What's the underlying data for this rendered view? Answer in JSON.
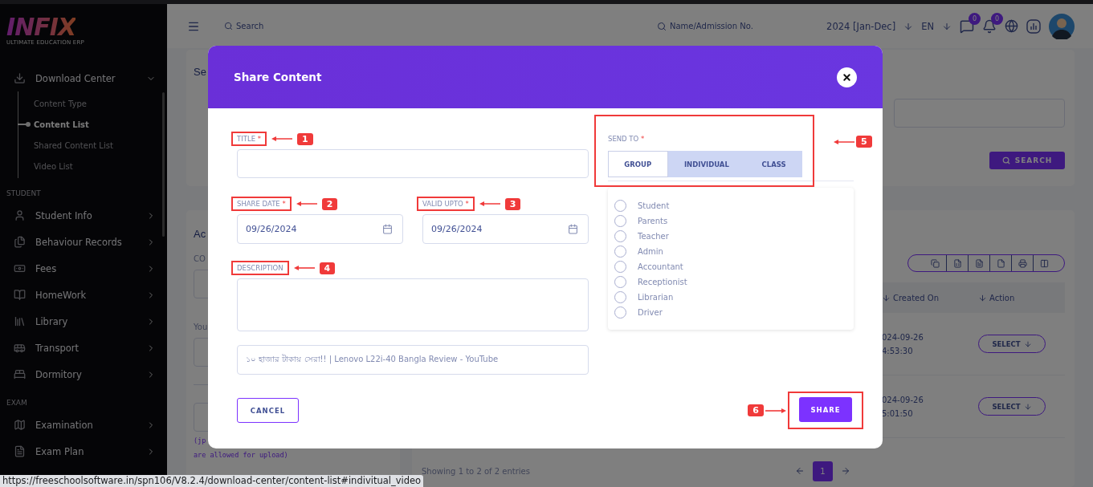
{
  "sidebar": {
    "logo": "INFIX",
    "tagline": "ULTIMATE EDUCATION ERP",
    "sections": [
      {
        "items": [
          {
            "label": "Download Center",
            "expanded": true,
            "children": [
              {
                "label": "Content Type",
                "selected": false
              },
              {
                "label": "Content List",
                "selected": true
              },
              {
                "label": "Shared Content List",
                "selected": false
              },
              {
                "label": "Video List",
                "selected": false
              }
            ]
          }
        ]
      },
      {
        "heading": "STUDENT",
        "items": [
          {
            "label": "Student Info",
            "expanded": false
          },
          {
            "label": "Behaviour Records",
            "expanded": false
          },
          {
            "label": "Fees",
            "expanded": false
          },
          {
            "label": "HomeWork",
            "expanded": false
          },
          {
            "label": "Library",
            "expanded": false
          },
          {
            "label": "Transport",
            "expanded": false
          },
          {
            "label": "Dormitory",
            "expanded": false
          }
        ]
      },
      {
        "heading": "EXAM",
        "items": [
          {
            "label": "Examination",
            "expanded": false
          },
          {
            "label": "Exam Plan",
            "expanded": false
          }
        ]
      }
    ]
  },
  "topbar": {
    "search_placeholder": "Search",
    "student_search_placeholder": "Name/Admission No.",
    "session": "2024 [Jan-Dec]",
    "language": "EN",
    "message_count": "0",
    "notification_count": "0"
  },
  "background": {
    "search_card": {
      "title": "Se",
      "search_button": "SEARCH"
    },
    "add_card": {
      "title": "Ac",
      "field_label": "CO",
      "second_label": "You",
      "note_start": "(jp",
      "note_end": "are allowed for upload)"
    },
    "list_card": {
      "columns": [
        "Created On",
        "Action"
      ],
      "rows": [
        {
          "date": "024-09-26",
          "time": "4:53:30",
          "action": "SELECT"
        },
        {
          "date": "024-09-26",
          "time": "5:01:50",
          "action": "SELECT"
        }
      ],
      "summary": "Showing 1 to 2 of 2 entries",
      "pages": [
        {
          "label": "1",
          "selected": true
        }
      ]
    }
  },
  "modal": {
    "title": "Share Content",
    "title_field": {
      "label": "TITLE",
      "required_mark": "*",
      "annotation": "1"
    },
    "share_date": {
      "label": "SHARE DATE",
      "required_mark": "*",
      "value": "09/26/2024",
      "annotation": "2"
    },
    "valid_upto": {
      "label": "VALID UPTO",
      "required_mark": "*",
      "value": "09/26/2024",
      "annotation": "3"
    },
    "description": {
      "label": "DESCRIPTION",
      "annotation": "4"
    },
    "url_value": "১০ হাজার টাকায় সেরা!! | Lenovo L22i-40 Bangla Review - YouTube",
    "send_to": {
      "label": "SEND TO",
      "required_mark": "*",
      "annotation": "5",
      "tabs": [
        {
          "label": "GROUP",
          "selected": true
        },
        {
          "label": "INDIVIDUAL",
          "selected": false
        },
        {
          "label": "CLASS",
          "selected": false
        }
      ],
      "roles": [
        {
          "label": "Student",
          "checked": false
        },
        {
          "label": "Parents",
          "checked": false
        },
        {
          "label": "Teacher",
          "checked": false
        },
        {
          "label": "Admin",
          "checked": false
        },
        {
          "label": "Accountant",
          "checked": false
        },
        {
          "label": "Receptionist",
          "checked": false
        },
        {
          "label": "Librarian",
          "checked": false
        },
        {
          "label": "Driver",
          "checked": false
        }
      ]
    },
    "cancel_button": "CANCEL",
    "share_button": {
      "label": "SHARE",
      "annotation": "6"
    }
  },
  "status_url": "https://freeschoolsoftware.in/spn106/V8.2.4/download-center/content-list#indivitual_video"
}
